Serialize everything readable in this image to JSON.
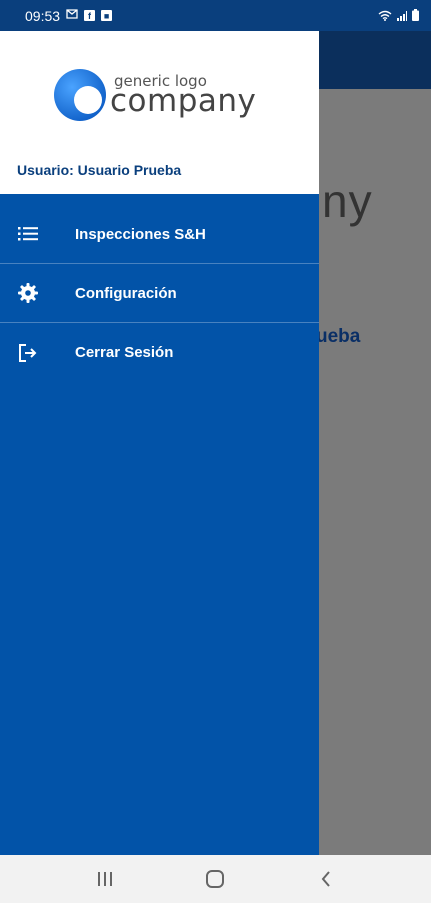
{
  "status_bar": {
    "time": "09:53",
    "icons": [
      "mail-icon",
      "facebook-icon",
      "notification-icon",
      "wifi-icon",
      "signal-icon",
      "battery-icon"
    ]
  },
  "background": {
    "partial_title": "ny",
    "partial_user": "ueba"
  },
  "drawer": {
    "logo": {
      "small_text": "generic logo",
      "big_text": "company"
    },
    "user_label": "Usuario: Usuario Prueba",
    "items": [
      {
        "label": "Inspecciones S&H",
        "icon": "list-icon"
      },
      {
        "label": "Configuración",
        "icon": "gear-icon"
      },
      {
        "label": "Cerrar Sesión",
        "icon": "logout-icon"
      }
    ]
  },
  "nav": {
    "buttons": [
      "recent-apps",
      "home",
      "back"
    ]
  },
  "colors": {
    "drawer_bg": "#0253a8",
    "status_bar": "#0a3f7d",
    "toolbar": "#0b2f5c",
    "scrim": "#7b7b7b"
  }
}
